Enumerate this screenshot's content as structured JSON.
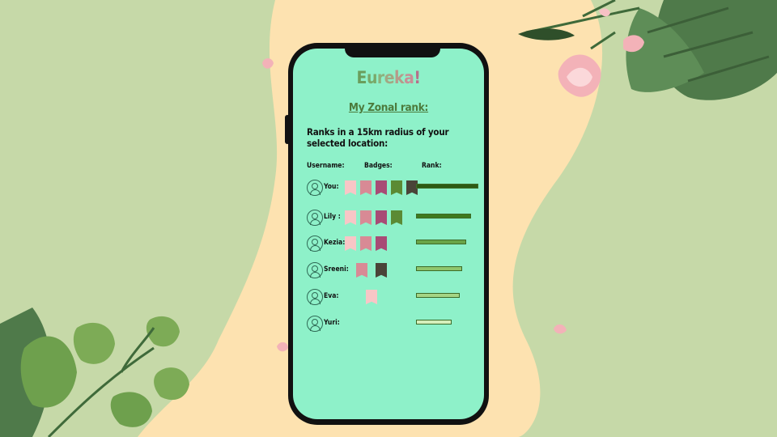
{
  "app": {
    "title": "Eureka!",
    "title_colors": [
      "#6a9e5c",
      "#79a96a",
      "#8db07c",
      "#a2a883",
      "#b79a8a",
      "#c68f96",
      "#b5708a"
    ]
  },
  "subtitle": "My Zonal rank:",
  "description": "Ranks in a 15km radius of your selected location:",
  "columns": {
    "username": "Username:",
    "badges": "Badges:",
    "rank": "Rank:"
  },
  "colors": {
    "background": "#c6d9a8",
    "blob": "#fde2b0",
    "screen": "#8ef1c9",
    "badge_light_pink": "#f8c6c6",
    "badge_mid_pink": "#d88a95",
    "badge_magenta": "#a84b75",
    "badge_green": "#5b8a34",
    "badge_dark": "#4a4438"
  },
  "users": [
    {
      "name": "You:",
      "badges": [
        "light_pink",
        "mid_pink",
        "magenta",
        "green",
        "dark"
      ],
      "rank_level": 1.0,
      "bar_color": "#2d5a14"
    },
    {
      "name": "Lily :",
      "badges": [
        "light_pink",
        "mid_pink",
        "magenta",
        "green"
      ],
      "rank_level": 0.88,
      "bar_color": "#3e7a1e"
    },
    {
      "name": "Kezia:",
      "badges": [
        "light_pink",
        "mid_pink",
        "magenta"
      ],
      "rank_level": 0.8,
      "bar_color": "#6aa448"
    },
    {
      "name": "Sreeni:",
      "badges": [
        "mid_pink",
        "dark"
      ],
      "rank_level": 0.74,
      "bar_color": "#8fc56c"
    },
    {
      "name": "Eva:",
      "badges": [
        "light_pink"
      ],
      "rank_level": 0.7,
      "bar_color": "#a5d585"
    },
    {
      "name": "Yuri:",
      "badges": [],
      "rank_level": 0.57,
      "bar_color": "#d5efbb"
    }
  ]
}
